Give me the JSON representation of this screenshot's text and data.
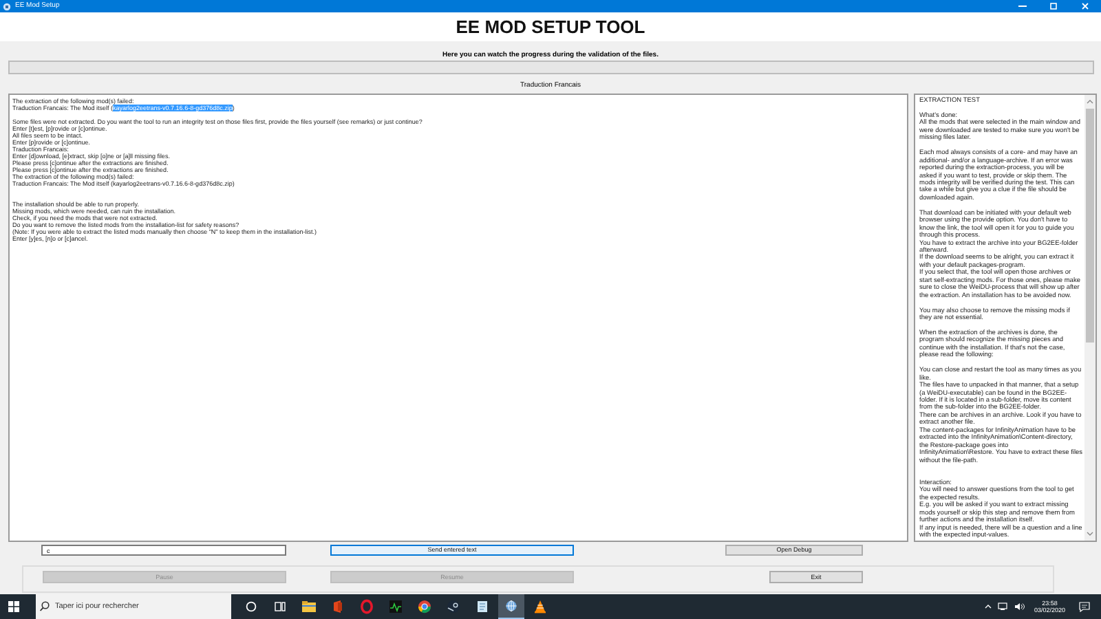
{
  "window": {
    "title": "EE Mod Setup"
  },
  "header": {
    "title": "EE MOD SETUP TOOL"
  },
  "subtitle": "Here you can watch the progress during the validation of the files.",
  "progress": {
    "level": 0
  },
  "section_label": "Traduction Francais",
  "log": {
    "paragraphs": [
      {
        "lines": [
          "The extraction of the following mod(s) failed:",
          {
            "parts": [
              {
                "text": "Traduction Francais: The Mod itself (",
                "selected": false
              },
              {
                "text": "kayarlog2eetrans-v0.7.16.6-8-gd376d8c.zip",
                "selected": true
              },
              {
                "text": ")",
                "selected": false
              }
            ]
          }
        ]
      },
      {
        "lines": [
          "Some files were not extracted. Do you want the tool to run an integrity test on those files first, provide the files yourself (see remarks) or just continue?",
          "Enter [t]est, [p]rovide or [c]ontinue.",
          "All files seem to be intact.",
          "Enter [p]rovide or [c]ontinue.",
          "Traduction Francais:",
          "Enter [d]ownload, [e]xtract, skip [o]ne or [a]ll missing files.",
          "Please press [c]ontinue after the extractions are finished.",
          "Please press [c]ontinue after the extractions are finished.",
          "The extraction of the following mod(s) failed:",
          "Traduction Francais: The Mod itself (kayarlog2eetrans-v0.7.16.6-8-gd376d8c.zip)"
        ]
      },
      {
        "lines": [
          "The installation should be able to run properly.",
          "Missing mods, which were needed, can ruin the installation.",
          "Check, if you need the mods that were not extracted.",
          "Do you want to remove the listed mods from the installation-list for safety reasons?",
          "(Note: If you were able to extract the listed mods manually then choose \"N\" to keep them in the installation-list.)",
          "Enter [y]es, [n]o or [c]ancel."
        ]
      }
    ]
  },
  "help": {
    "paragraphs": [
      {
        "lines": [
          "EXTRACTION TEST"
        ]
      },
      {
        "lines": [
          "What's done:",
          "All the mods that were selected in the main window and were downloaded are tested to make sure you won't be missing files later."
        ]
      },
      {
        "lines": [
          "Each mod always consists of a core- and may have an additional- and/or a language-archive. If an error was reported during the extraction-process, you will be asked if you want to test, provide or skip them. The mods integrity will be verified during the test. This can take a while but give you a clue if the file should be downloaded again."
        ]
      },
      {
        "lines": [
          "That download can be initiated with your default web browser using the provide option. You don't have to know the link, the tool will open it for you to guide you through this process.",
          "You have to extract the archive into your BG2EE-folder afterward.",
          "If the download seems to be alright, you can extract it with your default packages-program.",
          "If you select that, the tool will open those archives or start self-extracting mods. For those ones, please make sure to close the WeiDU-process that will show up after the extraction. An installation has to be avoided now."
        ]
      },
      {
        "lines": [
          "You may also choose to remove the missing mods if they are not essential."
        ]
      },
      {
        "lines": [
          "When the extraction of the archives is done, the program should recognize the missing pieces and continue with the installation. If that's not the case, please read the following:"
        ]
      },
      {
        "lines": [
          "You can close and restart the tool as many times as you like.",
          "The files have to unpacked in that manner, that a setup (a WeiDU-executable) can be found in the BG2EE-folder. If it is located in a sub-folder, move its content from the sub-folder into the BG2EE-folder.",
          "There can be archives in an archive. Look if you have to extract another file.",
          "The content-packages for InfinityAnimation have to be extracted into the InfinityAnimation\\Content-directory, the Restore-package goes into InfinityAnimation\\Restore. You have to extract these files without the file-path."
        ]
      },
      {
        "lines": [
          "Interaction:",
          "You will need to answer questions from the tool to get the expected results.",
          "E.g. you will be asked if you want to extract missing mods yourself or skip this step and remove them from further actions and the installation itself.",
          "If any input is needed, there will be a question and a line with the expected input-values."
        ]
      }
    ]
  },
  "input": {
    "value": "c"
  },
  "buttons_row1": [
    {
      "label": "Send entered text",
      "focused": true,
      "disabled": false
    },
    {
      "label": "Open Debug",
      "focused": false,
      "disabled": false
    }
  ],
  "buttons_row2": [
    {
      "label": "Pause",
      "focused": false,
      "disabled": true
    },
    {
      "label": "Resume",
      "focused": false,
      "disabled": true
    },
    {
      "label": "Exit",
      "focused": false,
      "disabled": false
    }
  ],
  "taskbar": {
    "search_placeholder": "Taper ici pour rechercher",
    "apps": [
      {
        "kind": "circle",
        "selected": false
      },
      {
        "kind": "taskview",
        "selected": false
      },
      {
        "kind": "folder",
        "selected": false
      },
      {
        "kind": "redtile",
        "selected": false
      },
      {
        "kind": "ring",
        "selected": false
      },
      {
        "kind": "chart",
        "selected": false
      },
      {
        "kind": "wheel",
        "selected": false
      },
      {
        "kind": "disc",
        "selected": false
      },
      {
        "kind": "notepad",
        "selected": false
      },
      {
        "kind": "globe",
        "selected": true
      },
      {
        "kind": "cone",
        "selected": false
      }
    ],
    "time": "23:58",
    "date": "03/02/2020"
  }
}
